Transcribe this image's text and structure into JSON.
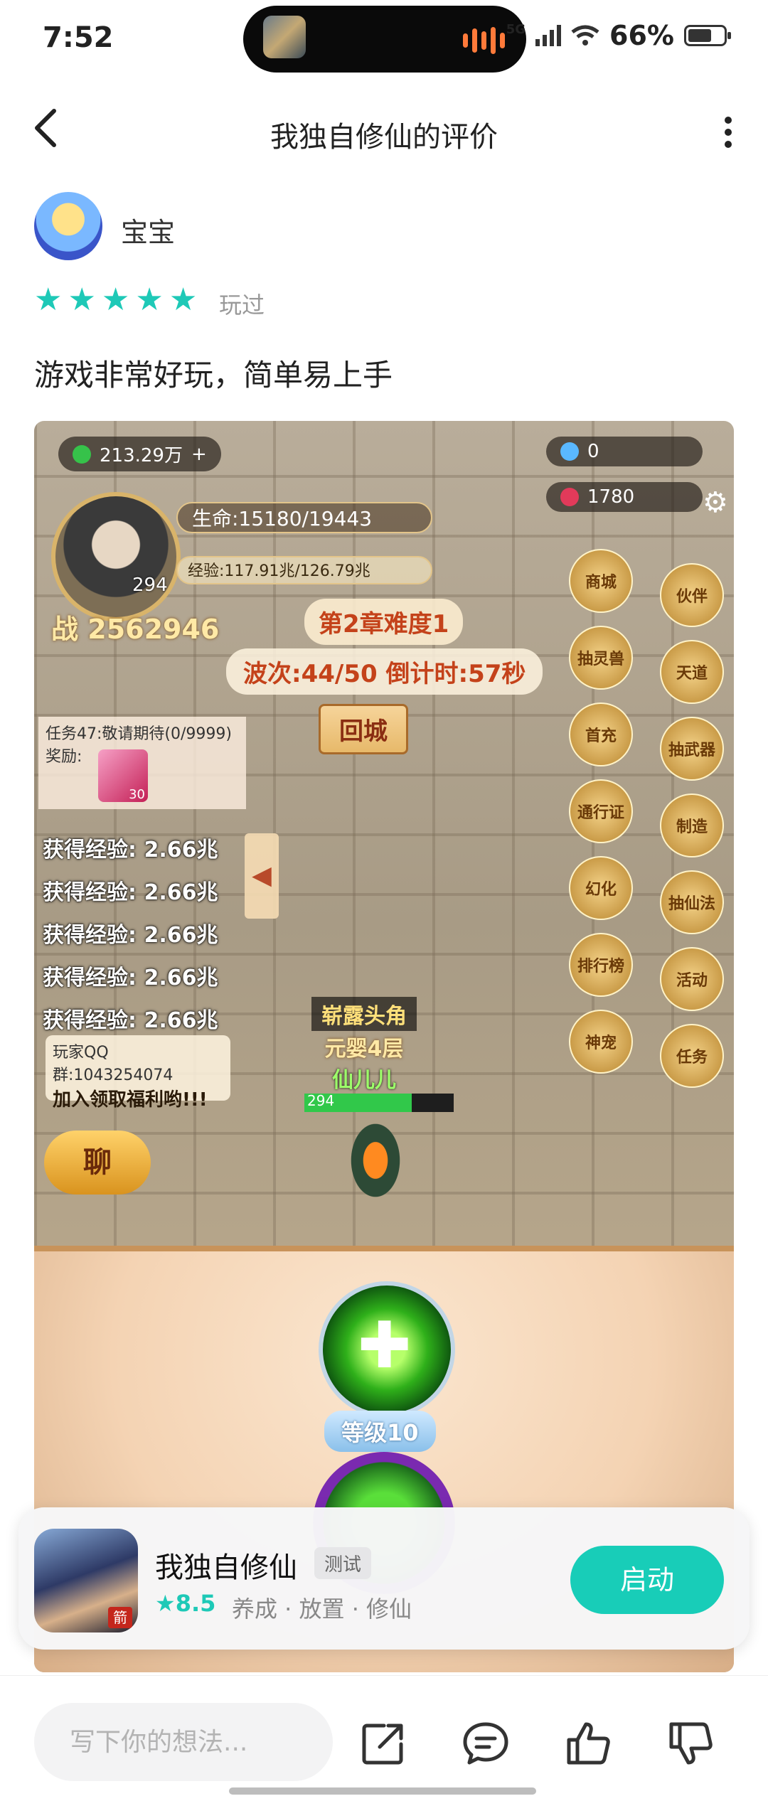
{
  "status_bar": {
    "time": "7:52",
    "network": "5G",
    "battery": "66%",
    "battery_level": 0.66
  },
  "header": {
    "back_icon": "chevron-left-icon",
    "title": "我独自修仙的评价",
    "more_icon": "more-vertical-icon"
  },
  "review": {
    "username": "宝宝",
    "rating_stars": 5,
    "played_label": "玩过",
    "text": "游戏非常好玩，简单易上手"
  },
  "game_screenshot": {
    "currency_top": "213.29万",
    "diamonds": "0",
    "rubies": "1780",
    "hp": "生命:15180/19443",
    "xp": "经验:117.91兆/126.79兆",
    "hero_level": "294",
    "power_label": "战",
    "power": "2562946",
    "chapter": "第2章难度1",
    "wave": "波次:44/50 倒计时:57秒",
    "return_button": "回城",
    "task": "任务47:敬请期待(0/9999)",
    "reward_label": "奖励:",
    "reward_count": "30",
    "xp_log": [
      "获得经验: 2.66兆",
      "获得经验: 2.66兆",
      "获得经验: 2.66兆",
      "获得经验: 2.66兆",
      "获得经验: 2.66兆"
    ],
    "qq_group": "玩家QQ群:1043254074",
    "qq_promo": "加入领取福利哟!!!",
    "chat_button": "聊",
    "char_title": "崭露头角",
    "char_realm": "元婴4层",
    "char_name": "仙儿儿",
    "char_hp": "294",
    "right_menu_left": [
      "商城",
      "抽灵兽",
      "首充",
      "通行证",
      "幻化",
      "排行榜",
      "神宠"
    ],
    "right_menu_right": [
      "伙伴",
      "天道",
      "抽武器",
      "制造",
      "抽仙法",
      "活动",
      "任务"
    ],
    "skill_level": "等级10"
  },
  "app_card": {
    "name": "我独自修仙",
    "tag": "测试",
    "rating": "8.5",
    "genres": "养成 · 放置 · 修仙",
    "launch_button": "启动",
    "icon_badge": "箭"
  },
  "bottom_bar": {
    "comment_placeholder": "写下你的想法...",
    "icons": [
      "share-icon",
      "comment-icon",
      "like-icon",
      "dislike-icon"
    ]
  },
  "colors": {
    "accent": "#18cdb8",
    "star": "#1ec9b7"
  }
}
